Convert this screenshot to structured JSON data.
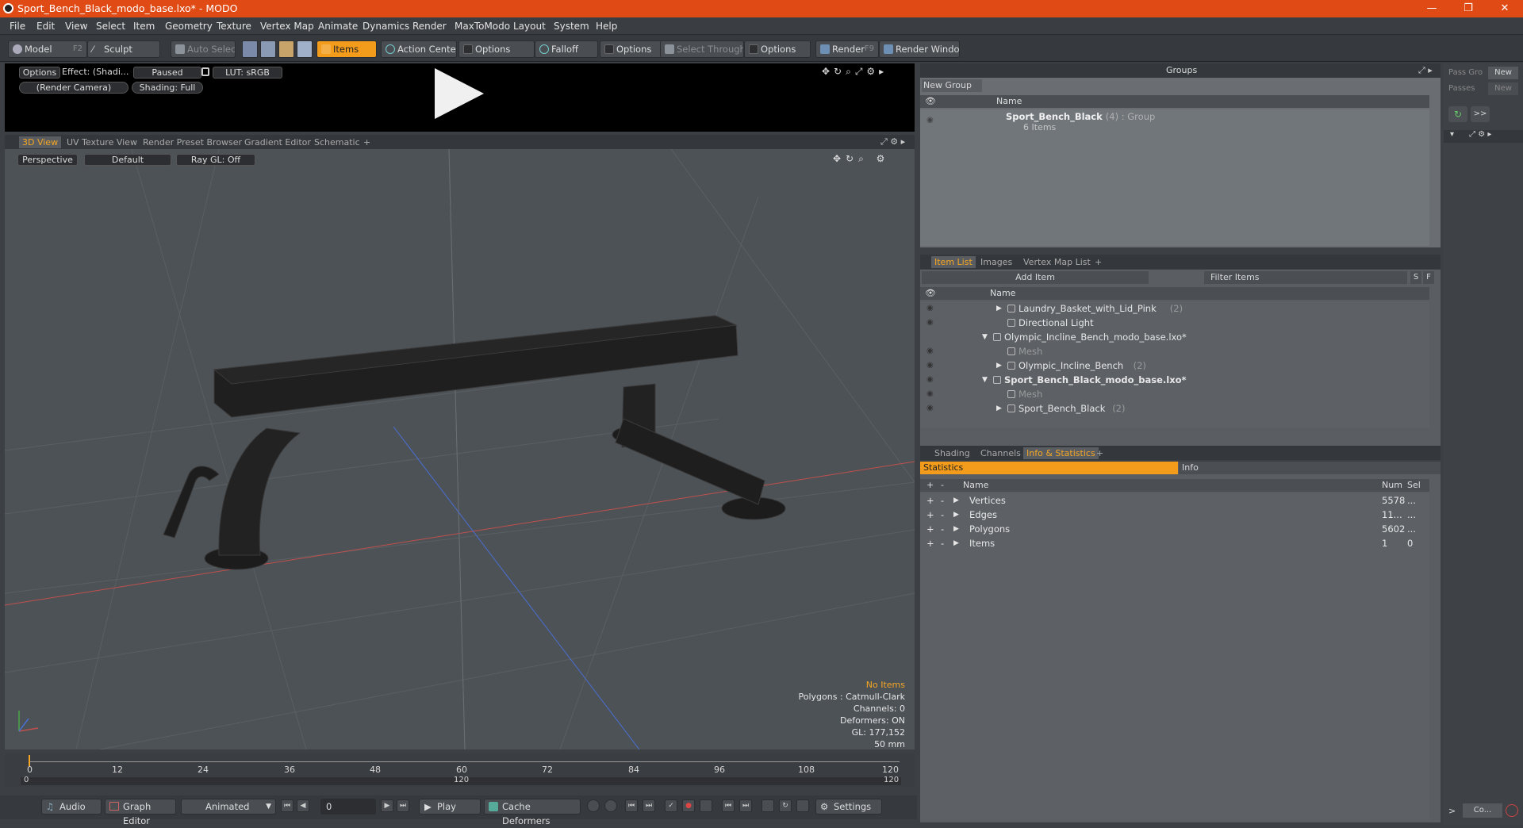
{
  "title": "Sport_Bench_Black_modo_base.lxo* - MODO",
  "window_controls": {
    "min": "—",
    "max": "❐",
    "close": "✕"
  },
  "menu": [
    "File",
    "Edit",
    "View",
    "Select",
    "Item",
    "Geometry",
    "Texture",
    "Vertex Map",
    "Animate",
    "Dynamics",
    "Render",
    "MaxToModo",
    "Layout",
    "System",
    "Help"
  ],
  "toolbar": {
    "model": "Model",
    "model_key": "F2",
    "sculpt": "Sculpt",
    "auto_select": "Auto Select",
    "items": "Items",
    "action_center": "Action Center",
    "options1": "Options",
    "falloff": "Falloff",
    "options2": "Options",
    "select_through": "Select Through",
    "options3": "Options",
    "render": "Render",
    "render_key": "F9",
    "render_window": "Render Window"
  },
  "preview": {
    "options": "Options",
    "effect": "Effect: (Shadi...",
    "paused": "Paused",
    "lut": "LUT: sRGB",
    "camera": "(Render Camera)",
    "shading": "Shading: Full"
  },
  "viewport_tabs": [
    "3D View",
    "UV Texture View",
    "Render Preset Browser",
    "Gradient Editor",
    "Schematic",
    "+"
  ],
  "viewport": {
    "perspective": "Perspective",
    "default": "Default",
    "raygl": "Ray GL: Off"
  },
  "viewport_info": {
    "no_items": "No Items",
    "polygons": "Polygons : Catmull-Clark",
    "channels": "Channels: 0",
    "deformers": "Deformers: ON",
    "gl": "GL: 177,152",
    "lens": "50 mm"
  },
  "timeline": {
    "ticks": [
      "0",
      "12",
      "24",
      "36",
      "48",
      "60",
      "72",
      "84",
      "96",
      "108",
      "120"
    ],
    "range_start": "0",
    "range_mid": "120",
    "range_end": "120"
  },
  "bottom": {
    "audio": "Audio",
    "graph_editor": "Graph Editor",
    "animated": "Animated",
    "frame": "0",
    "play": "Play",
    "cache_deformers": "Cache Deformers",
    "settings": "Settings"
  },
  "groups": {
    "title": "Groups",
    "new_group": "New Group",
    "name_col": "Name",
    "item_name": "Sport_Bench_Black",
    "item_meta": "(4) : Group",
    "item_count": "6 Items"
  },
  "item_list": {
    "tabs": [
      "Item List",
      "Images",
      "Vertex Map List",
      "+"
    ],
    "add_item": "Add Item",
    "filter": "Filter Items",
    "s": "S",
    "f": "F",
    "name_col": "Name",
    "rows": [
      {
        "indent": 1,
        "arrow": "▶",
        "label": "Laundry_Basket_with_Lid_Pink",
        "meta": "(2)",
        "eye": true,
        "bold": false,
        "dim": false
      },
      {
        "indent": 1,
        "arrow": "",
        "label": "Directional Light",
        "meta": "",
        "eye": true,
        "bold": false,
        "dim": false
      },
      {
        "indent": 0,
        "arrow": "▼",
        "label": "Olympic_Incline_Bench_modo_base.lxo*",
        "meta": "",
        "eye": false,
        "bold": false,
        "dim": false
      },
      {
        "indent": 1,
        "arrow": "",
        "label": "Mesh",
        "meta": "",
        "eye": true,
        "bold": false,
        "dim": true
      },
      {
        "indent": 1,
        "arrow": "▶",
        "label": "Olympic_Incline_Bench",
        "meta": "(2)",
        "eye": true,
        "bold": false,
        "dim": false
      },
      {
        "indent": 0,
        "arrow": "▼",
        "label": "Sport_Bench_Black_modo_base.lxo*",
        "meta": "",
        "eye": true,
        "bold": true,
        "dim": false
      },
      {
        "indent": 1,
        "arrow": "",
        "label": "Mesh",
        "meta": "",
        "eye": true,
        "bold": false,
        "dim": true
      },
      {
        "indent": 1,
        "arrow": "▶",
        "label": "Sport_Bench_Black",
        "meta": "(2)",
        "eye": true,
        "bold": false,
        "dim": false
      }
    ]
  },
  "stats": {
    "tabs": [
      "Shading",
      "Channels",
      "Info & Statistics",
      "+"
    ],
    "statistics": "Statistics",
    "info": "Info",
    "cols": {
      "name": "Name",
      "num": "Num",
      "sel": "Sel"
    },
    "rows": [
      {
        "name": "Vertices",
        "num": "5578",
        "sel": "..."
      },
      {
        "name": "Edges",
        "num": "11...",
        "sel": "..."
      },
      {
        "name": "Polygons",
        "num": "5602",
        "sel": "..."
      },
      {
        "name": "Items",
        "num": "1",
        "sel": "0"
      }
    ]
  },
  "pass": {
    "pass_group": "Pass Gro",
    "new1": "New",
    "passes": "Passes",
    "new2": "New",
    "more": ">>",
    "co": "Co..."
  },
  "colors": {
    "accent": "#f39c1c",
    "titlebar": "#e04a14",
    "xaxis": "#c0504d",
    "zaxis": "#4a6fd1"
  }
}
